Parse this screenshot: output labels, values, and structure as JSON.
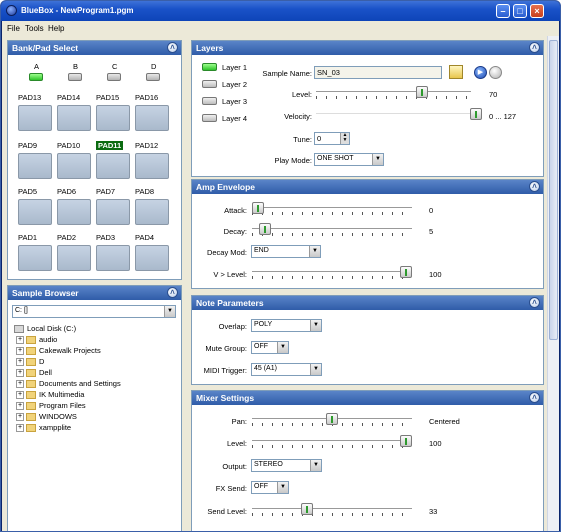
{
  "window": {
    "title": "BlueBox - NewProgram1.pgm"
  },
  "menu": [
    "File",
    "Tools",
    "Help"
  ],
  "bank": {
    "title": "Bank/Pad Select",
    "banks": [
      "A",
      "B",
      "C",
      "D"
    ],
    "active_bank": "A",
    "pads": [
      "PAD13",
      "PAD14",
      "PAD15",
      "PAD16",
      "PAD9",
      "PAD10",
      "PAD11",
      "PAD12",
      "PAD5",
      "PAD6",
      "PAD7",
      "PAD8",
      "PAD1",
      "PAD2",
      "PAD3",
      "PAD4"
    ],
    "selected_pad": "PAD11"
  },
  "browser": {
    "title": "Sample Browser",
    "drive": "C: []",
    "items": [
      "Local Disk (C:)",
      "audio",
      "Cakewalk Projects",
      "D",
      "Dell",
      "Documents and Settings",
      "IK Multimedia",
      "Program Files",
      "WINDOWS",
      "xampplite"
    ]
  },
  "layers": {
    "title": "Layers",
    "buttons": [
      "Layer 1",
      "Layer 2",
      "Layer 3",
      "Layer 4"
    ],
    "active": "Layer 1",
    "sample_name_label": "Sample Name:",
    "sample_name": "SN_03",
    "level_label": "Level:",
    "level_value": "70",
    "velocity_label": "Velocity:",
    "velocity_value": "0 ... 127",
    "tune_label": "Tune:",
    "tune_value": "0",
    "playmode_label": "Play Mode:",
    "playmode_value": "ONE SHOT"
  },
  "amp": {
    "title": "Amp Envelope",
    "attack_label": "Attack:",
    "attack_value": "0",
    "decay_label": "Decay:",
    "decay_value": "5",
    "decaymod_label": "Decay Mod:",
    "decaymod_value": "END",
    "vlevel_label": "V > Level:",
    "vlevel_value": "100"
  },
  "note": {
    "title": "Note Parameters",
    "overlap_label": "Overlap:",
    "overlap_value": "POLY",
    "mutegroup_label": "Mute Group:",
    "mutegroup_value": "OFF",
    "midi_label": "MIDI Trigger:",
    "midi_value": "45 (A1)"
  },
  "mixer": {
    "title": "Mixer Settings",
    "pan_label": "Pan:",
    "pan_value": "Centered",
    "level_label": "Level:",
    "level_value": "100",
    "output_label": "Output:",
    "output_value": "STEREO",
    "fxsend_label": "FX Send:",
    "fxsend_value": "OFF",
    "sendlevel_label": "Send Level:",
    "sendlevel_value": "33"
  },
  "sliders": {
    "layer_level": 0.7,
    "velocity": 1.0,
    "attack": 0.0,
    "decay": 0.05,
    "vlevel": 1.0,
    "pan": 0.5,
    "mixer_level": 1.0,
    "send_level": 0.33
  },
  "colors": {
    "title_bar": "#1a52c8",
    "panel_header": "#2f5ca8",
    "selected_pad": "#0b6b10",
    "led_on": "#2ec52a"
  }
}
